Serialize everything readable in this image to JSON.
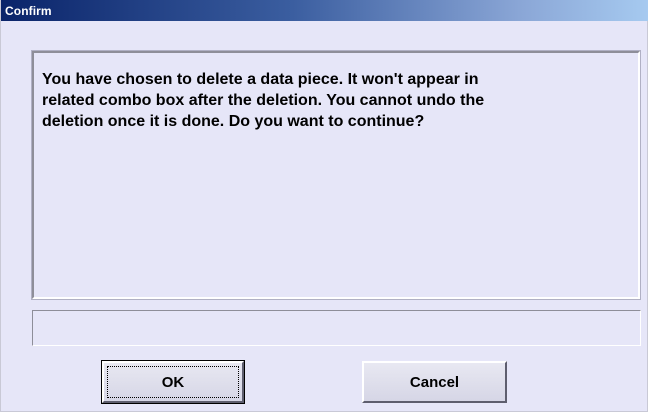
{
  "window": {
    "title": "Confirm"
  },
  "message": {
    "text": "You have chosen to delete a data piece. It won't appear in\nrelated combo box after the deletion. You cannot undo the\ndeletion once it is done.  Do you want to continue?"
  },
  "status": {
    "text": ""
  },
  "buttons": {
    "ok_label": "OK",
    "cancel_label": "Cancel"
  },
  "colors": {
    "dialog_background": "#e6e6f8",
    "title_gradient_start": "#0a246a",
    "title_gradient_end": "#a6caf0"
  }
}
